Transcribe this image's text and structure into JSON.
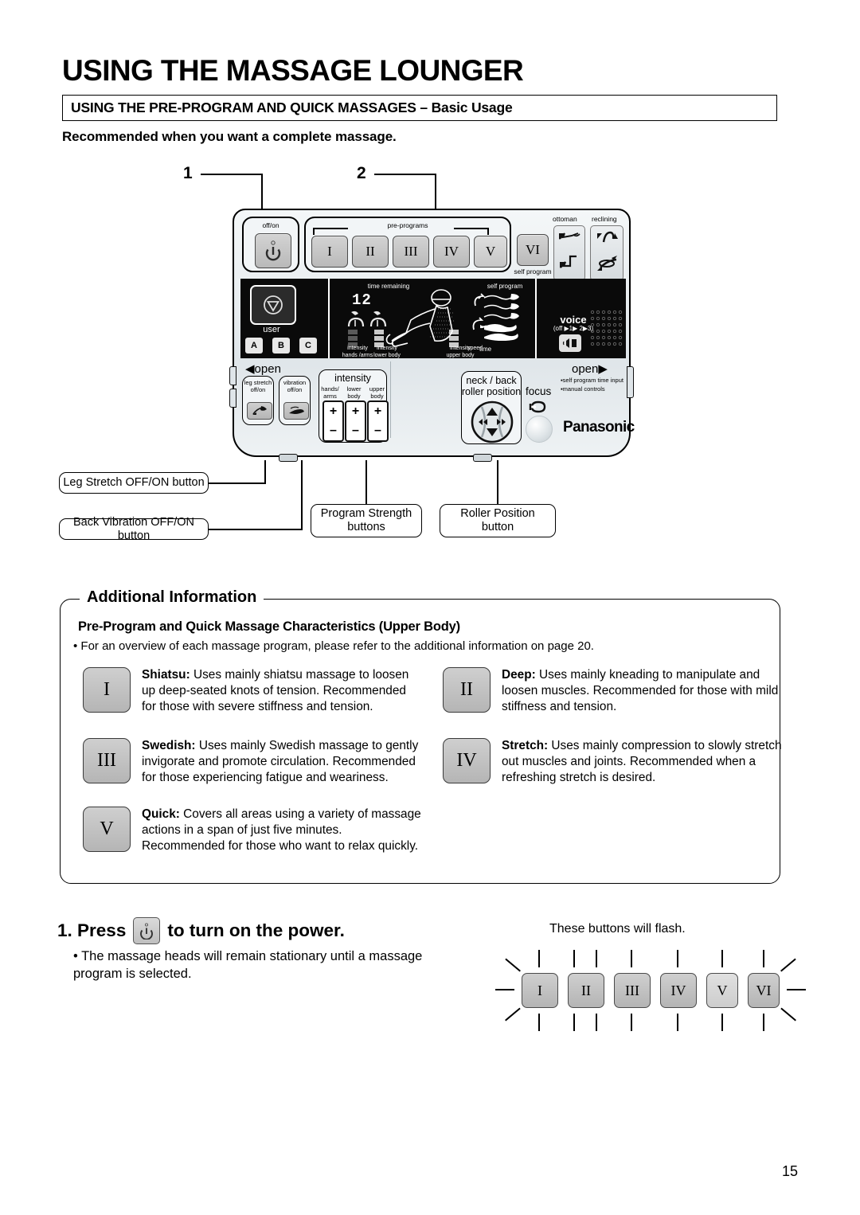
{
  "header": {
    "title": "USING THE MASSAGE LOUNGER",
    "subtitle": "USING THE PRE-PROGRAM AND QUICK MASSAGES  – Basic Usage",
    "lead_in": "Recommended when you want a complete massage."
  },
  "diagram": {
    "callouts": [
      "1",
      "2"
    ],
    "panel": {
      "power_group_label": "off/on",
      "preprograms_label": "pre-programs",
      "preprogram_buttons": [
        "I",
        "II",
        "III",
        "IV",
        "V"
      ],
      "self_program_button": "VI",
      "self_program_label": "self program",
      "ottoman_label": "ottoman",
      "reclining_label": "reclining",
      "user_label": "user",
      "user_buttons": [
        "A",
        "B",
        "C"
      ],
      "lcd": {
        "time_remaining_label": "time remaining",
        "time_value": "12",
        "intensity_hands_arms": "intensity\nhands /arms",
        "intensity_lower_body": "intensity\nlower body",
        "intensity_upper_body": "intensity\nupper body",
        "speed_label": "speed",
        "self_program_label": "self program",
        "time_label": "time",
        "voice_label": "voice",
        "voice_steps": "(off ▶1▶ 2▶3)"
      },
      "open_left": "◀open",
      "open_right": "open▶",
      "leg_stretch_label": "leg stretch\noff/on",
      "vibration_label": "vibration\noff/on",
      "intensity_label": "intensity",
      "intensity_cols": [
        "hands/\narms",
        "lower\nbody",
        "upper\nbody"
      ],
      "roller_label": "neck / back\nroller position",
      "focus_label": "focus",
      "open_right_notes": [
        "self program time input",
        "manual controls"
      ],
      "brand": "Panasonic"
    },
    "captions": [
      "Leg Stretch OFF/ON button",
      "Back Vibration OFF/ON button",
      "Program Strength\nbuttons",
      "Roller Position\nbutton"
    ]
  },
  "additional_information": {
    "title": "Additional Information",
    "subtitle": "Pre-Program and Quick Massage Characteristics (Upper Body)",
    "bullet": "• For an overview of each massage program, please refer to the additional information on page 20.",
    "items": [
      {
        "key": "I",
        "name": "Shiatsu:",
        "text": " Uses mainly shiatsu massage to loosen up deep-seated knots of tension. Recommended for those with severe stiffness and tension."
      },
      {
        "key": "II",
        "name": "Deep:",
        "text": " Uses mainly kneading to manipulate and loosen muscles. Recommended for those with mild stiffness and tension."
      },
      {
        "key": "III",
        "name": "Swedish:",
        "text": " Uses mainly Swedish massage to gently invigorate and promote circulation. Recommended for those experiencing fatigue and weariness."
      },
      {
        "key": "IV",
        "name": "Stretch:",
        "text": " Uses mainly compression to slowly stretch out muscles and joints. Recommended when a refreshing stretch is desired."
      },
      {
        "key": "V",
        "name": "Quick:",
        "text": " Covers all areas using a variety of massage actions in a span of just five minutes. Recommended for those who want to relax quickly."
      }
    ]
  },
  "step": {
    "number": "1.",
    "press_word": "Press",
    "rest": "to turn on the power.",
    "bullet": "• The massage heads will remain stationary until a massage\n   program is selected.",
    "flash_caption": "These buttons will flash.",
    "flash_buttons": [
      "I",
      "II",
      "III",
      "IV",
      "V",
      "VI"
    ]
  },
  "page_number": "15",
  "colors": {
    "ink": "#000000",
    "key_face": "#c6c6c6",
    "lcd_bg": "#0a0a0a",
    "panel_bg": "#eef2f4"
  }
}
